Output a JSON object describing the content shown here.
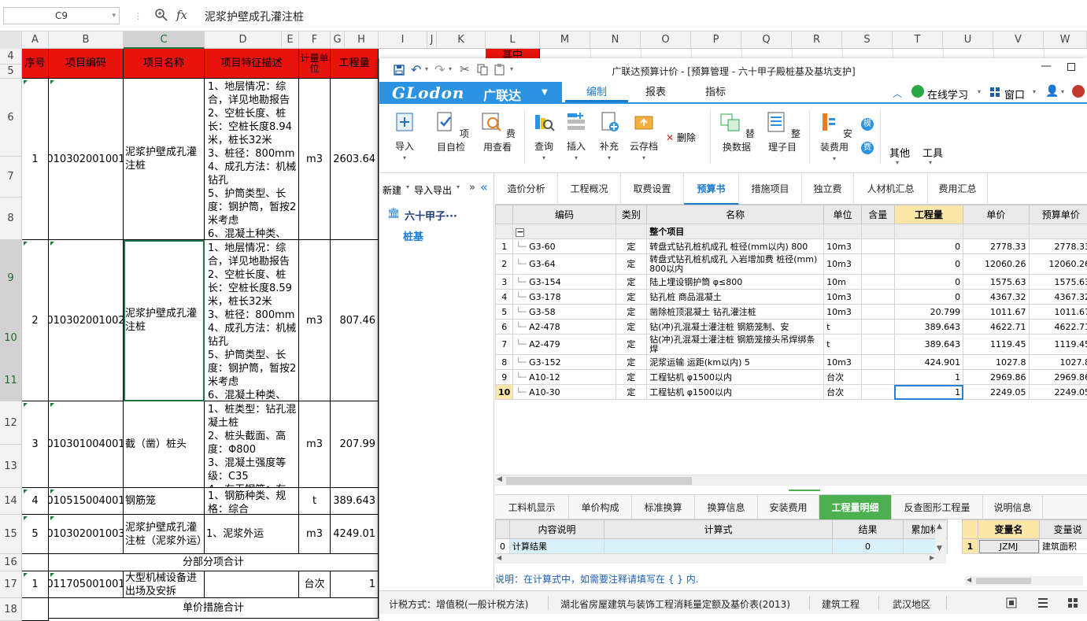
{
  "excel": {
    "name_box": "C9",
    "fx_label": "fx",
    "formula_value": "泥浆护壁成孔灌注桩",
    "columns": [
      "A",
      "B",
      "C",
      "D",
      "E",
      "F",
      "G",
      "H",
      "I",
      "J",
      "K",
      "L",
      "M",
      "N",
      "O",
      "P",
      "Q",
      "R",
      "S",
      "T",
      "U",
      "V",
      "W"
    ],
    "row_numbers": [
      "4",
      "5",
      "6",
      "7",
      "8",
      "9",
      "10",
      "11",
      "12",
      "13",
      "14",
      "15",
      "16",
      "17",
      "18"
    ],
    "header": {
      "seq": "序号",
      "code": "项目编码",
      "name": "项目名称",
      "desc": "项目特征描述",
      "unit": "计量单位",
      "qty": "工程量",
      "extra": "其中"
    },
    "rows": [
      {
        "seq": "1",
        "code": "010302001001",
        "name": "泥浆护壁成孔灌注桩",
        "desc": "1、地层情况：综合，详见地勘报告\n2、空桩长度、桩长：空桩长度8.94米，桩长32米\n3、桩径：800mm\n4、成孔方法：机械钻孔\n5、护筒类型、长度：钢护筒，暂按2米考虑\n6、混凝土种类、",
        "unit": "m3",
        "qty": "2603.64"
      },
      {
        "seq": "2",
        "code": "010302001002",
        "name": "泥浆护壁成孔灌注桩",
        "desc": "1、地层情况：综合，详见地勘报告\n2、空桩长度、桩长：空桩长度8.59米，桩长32米\n3、桩径：800mm\n4、成孔方法：机械钻孔\n5、护筒类型、长度：钢护筒，暂按2米考虑\n6、混凝土种类、",
        "unit": "m3",
        "qty": "807.46"
      },
      {
        "seq": "3",
        "code": "010301004001",
        "name": "截（凿）桩头",
        "desc": "1、桩类型：钻孔混凝土桩\n2、桩头截面、高度：Φ800\n3、混凝土强度等级：C35\n4、有无钢筋：有",
        "unit": "m3",
        "qty": "207.99"
      },
      {
        "seq": "4",
        "code": "010515004001",
        "name": "钢筋笼",
        "desc": "1、钢筋种类、规格：综合",
        "unit": "t",
        "qty": "389.643"
      },
      {
        "seq": "5",
        "code": "010302001003",
        "name": "泥浆护壁成孔灌注桩（泥浆外运）",
        "desc": "1、泥浆外运",
        "unit": "m3",
        "qty": "4249.01"
      },
      {
        "seq": "",
        "code": "",
        "name": "分部分项合计",
        "desc": "",
        "unit": "",
        "qty": ""
      },
      {
        "seq": "1",
        "code": "011705001001",
        "name": "大型机械设备进出场及安拆",
        "desc": "",
        "unit": "台次",
        "qty": "1"
      },
      {
        "seq": "",
        "code": "",
        "name": "单价措施合计",
        "desc": "",
        "unit": "",
        "qty": ""
      }
    ]
  },
  "glodon": {
    "title": "广联达预算计价 - [预算管理 - 六十甲子殿桩基及基坑支护]",
    "brand": "GLodon",
    "brand_cn": "广联达",
    "main_tabs": [
      "编制",
      "报表",
      "指标"
    ],
    "right_menu": {
      "online": "在线学习",
      "window": "窗口"
    },
    "ribbon": [
      "导入",
      "项目自检",
      "费用查看",
      "查询",
      "插入",
      "补充",
      "云存档",
      "删除",
      "替换数据",
      "整理子目",
      "安装费用",
      "其他",
      "工具"
    ],
    "ribbon_side": [
      "模",
      "费"
    ],
    "left_toolbar": {
      "new": "新建",
      "import_export": "导入导出"
    },
    "tree": {
      "project": "六十甲子···",
      "node": "桩基"
    },
    "sub_tabs": [
      "造价分析",
      "工程概况",
      "取费设置",
      "预算书",
      "措施项目",
      "独立费",
      "人材机汇总",
      "费用汇总"
    ],
    "table_headers": [
      "编码",
      "类别",
      "名称",
      "单位",
      "含量",
      "工程量",
      "单价",
      "预算单价"
    ],
    "whole_row": "整个项目",
    "table_rows": [
      {
        "n": "1",
        "code": "G3-60",
        "type": "定",
        "name": "转盘式钻孔桩机成孔 桩径(mm以内) 800",
        "unit": "10m3",
        "qty": "0",
        "price": "2778.33",
        "budget": "2778.33"
      },
      {
        "n": "2",
        "code": "G3-64",
        "type": "定",
        "name": "转盘式钻孔桩机成孔 入岩增加费 桩径(mm) 800以内",
        "unit": "10m3",
        "qty": "0",
        "price": "12060.26",
        "budget": "12060.26"
      },
      {
        "n": "3",
        "code": "G3-154",
        "type": "定",
        "name": "陆上埋设钢护筒 φ≤800",
        "unit": "10m",
        "qty": "0",
        "price": "1575.63",
        "budget": "1575.63"
      },
      {
        "n": "4",
        "code": "G3-178",
        "type": "定",
        "name": "钻孔桩 商品混凝土",
        "unit": "10m3",
        "qty": "0",
        "price": "4367.32",
        "budget": "4367.32"
      },
      {
        "n": "5",
        "code": "G3-58",
        "type": "定",
        "name": "凿除桩顶混凝土 钻孔灌注桩",
        "unit": "10m3",
        "qty": "20.799",
        "price": "1011.67",
        "budget": "1011.67"
      },
      {
        "n": "6",
        "code": "A2-478",
        "type": "定",
        "name": "钻(冲)孔混凝土灌注桩 钢筋笼制、安",
        "unit": "t",
        "qty": "389.643",
        "price": "4622.71",
        "budget": "4622.71"
      },
      {
        "n": "7",
        "code": "A2-479",
        "type": "定",
        "name": "钻(冲)孔混凝土灌注桩 钢筋笼接头吊焊绑条焊",
        "unit": "t",
        "qty": "389.643",
        "price": "1119.45",
        "budget": "1119.45"
      },
      {
        "n": "8",
        "code": "G3-152",
        "type": "定",
        "name": "泥浆运输 运距(km以内) 5",
        "unit": "10m3",
        "qty": "424.901",
        "price": "1027.8",
        "budget": "1027.8"
      },
      {
        "n": "9",
        "code": "A10-12",
        "type": "定",
        "name": "工程钻机 φ1500以内",
        "unit": "台次",
        "qty": "1",
        "price": "2969.86",
        "budget": "2969.86"
      },
      {
        "n": "10",
        "code": "A10-30",
        "type": "定",
        "name": "工程钻机 φ1500以内",
        "unit": "台次",
        "qty": "1",
        "price": "2249.05",
        "budget": "2249.05"
      }
    ],
    "bottom_tabs": [
      "工料机显示",
      "单价构成",
      "标准换算",
      "换算信息",
      "安装费用",
      "工程量明细",
      "反查图形工程量",
      "说明信息"
    ],
    "calc_headers": [
      "内容说明",
      "计算式",
      "结果",
      "累加标"
    ],
    "calc_row": {
      "n": "0",
      "desc": "计算结果",
      "formula": "",
      "result": "0"
    },
    "mini_headers": [
      "变量名",
      "变量说"
    ],
    "mini_row": {
      "n": "1",
      "var": "JZMJ",
      "desc": "建筑面积"
    },
    "note": "说明：在计算式中，如需要注释请填写在 { } 内.",
    "status": [
      "计税方式：增值税(一般计税方法)",
      "湖北省房屋建筑与装饰工程消耗量定额及基价表(2013)",
      "建筑工程",
      "武汉地区"
    ]
  }
}
